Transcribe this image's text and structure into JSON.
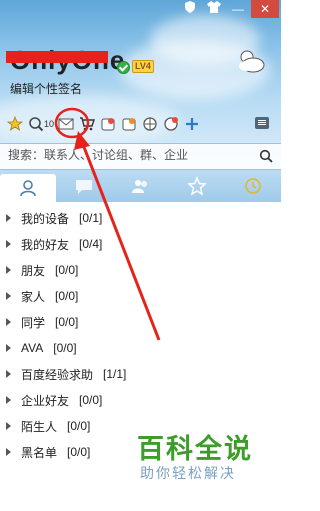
{
  "window": {
    "buttons": [
      {
        "name": "skin-button",
        "glyph": "👕"
      },
      {
        "name": "minimize-button",
        "glyph": "—"
      },
      {
        "name": "close-button",
        "glyph": "✕"
      }
    ]
  },
  "profile": {
    "nickname": "OnlyOne",
    "level_badge": "LV4",
    "signature": "编辑个性签名",
    "status": "online"
  },
  "toolbar": {
    "icons": [
      "star-icon",
      "search-people-icon",
      "mail-icon",
      "cart-icon",
      "wallet-icon",
      "app-icon",
      "ball-icon",
      "add-icon"
    ],
    "search_people_count": "10"
  },
  "search": {
    "placeholder": "搜索：联系人、讨论组、群、企业"
  },
  "tabs": [
    {
      "name": "contacts-tab",
      "icon": "person-icon",
      "active": true
    },
    {
      "name": "chat-tab",
      "icon": "chat-icon",
      "active": false
    },
    {
      "name": "groups-tab",
      "icon": "group-icon",
      "active": false
    },
    {
      "name": "favorites-tab",
      "icon": "star-icon",
      "active": false
    },
    {
      "name": "recent-tab",
      "icon": "recent-icon",
      "active": false
    }
  ],
  "groups": [
    {
      "name": "我的设备",
      "count": "[0/1]"
    },
    {
      "name": "我的好友",
      "count": "[0/4]"
    },
    {
      "name": "朋友",
      "count": "[0/0]"
    },
    {
      "name": "家人",
      "count": "[0/0]"
    },
    {
      "name": "同学",
      "count": "[0/0]"
    },
    {
      "name": "AVA",
      "count": "[0/0]"
    },
    {
      "name": "百度经验求助",
      "count": "[1/1]"
    },
    {
      "name": "企业好友",
      "count": "[0/0]"
    },
    {
      "name": "陌生人",
      "count": "[0/0]"
    },
    {
      "name": "黑名单",
      "count": "[0/0]"
    }
  ],
  "watermark": {
    "title": "百科全说",
    "subtitle": "助你轻松解决"
  },
  "colors": {
    "accent_red": "#e6231b",
    "watermark_green": "#3d9d2a"
  }
}
